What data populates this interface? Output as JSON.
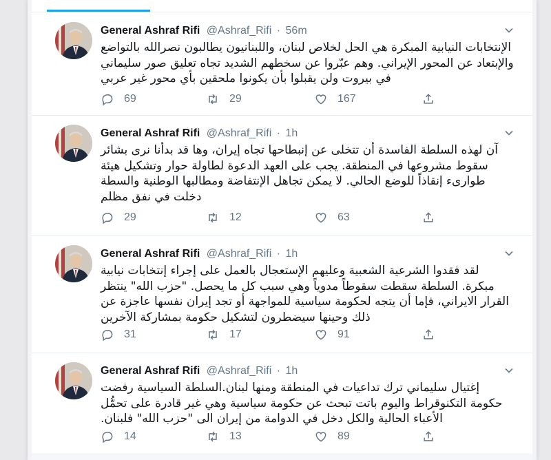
{
  "colors": {
    "accent": "#1da1f2",
    "text": "#14171a",
    "muted": "#657786",
    "divider": "#e6ecf0"
  },
  "icons": {
    "reply": "reply-icon",
    "retweet": "retweet-icon",
    "like": "heart-icon",
    "share": "share-icon",
    "menu": "chevron-down-icon"
  },
  "tweets": [
    {
      "name": "General Ashraf Rifi",
      "handle": "@Ashraf_Rifi",
      "separator": "·",
      "time": "56m",
      "text": "الإنتخابات النيابية المبكرة هي الحل لخلاص لبنان، واللبنانيون يطالبون نصرالله بالتواضع والإبتعاد عن المحور الإيراني. وهم عبّروا عن سخطهم الشديد تجاه تعليق صور سليماني في بيروت ولن يقبلوا بأن يكونوا ملحقين بأي محور غير عربي",
      "replies": "69",
      "retweets": "29",
      "likes": "167"
    },
    {
      "name": "General Ashraf Rifi",
      "handle": "@Ashraf_Rifi",
      "separator": "·",
      "time": "1h",
      "text": "آن لهذه السلطة الفاسدة أن تتخلى عن إنبطاحها تجاه إيران، وها قد بدأنا نرى بشائر سقوط مشروعها في المنطقة. يجب على العهد الدعوة لطاولة حوار وتشكيل هيئة طوارىء إنقاذاً للوضع الحالي. لا يمكن تجاهل الإنتفاضة ومطالبها الوطنية والسطة دخلت في نفق مظلم",
      "replies": "29",
      "retweets": "12",
      "likes": "63"
    },
    {
      "name": "General Ashraf Rifi",
      "handle": "@Ashraf_Rifi",
      "separator": "·",
      "time": "1h",
      "text": "لقد فقدوا الشرعية الشعبية وعليهم الإستعجال بالعمل على إجراء إنتخابات نيابية مبكرة. السلطة سقطت سقوطاً مدوياً وهي سبب كل ما يحصل. \"حزب الله\" ينتظر القرار الايراني، فإما أن يتجه لحكومة سياسية للمواجهة أو تجد إيران نفسها عاجزة عن ذلك وحينها سيضطرون لتشكيل حكومة بمشاركة الآخرين",
      "replies": "31",
      "retweets": "17",
      "likes": "91"
    },
    {
      "name": "General Ashraf Rifi",
      "handle": "@Ashraf_Rifi",
      "separator": "·",
      "time": "1h",
      "text": "إغتيال سليماني ترك تداعيات في المنطقة ومنها لبنان.السلطة السياسية رفضت حكومة التكنوقراط واليوم باتت تبحث عن حكومة سياسية وهي غير قادرة على تحمُّل الأعباء الحالية والكل دخل في الدوامة من إيران الى \"حزب الله\" فلبنان.",
      "replies": "14",
      "retweets": "13",
      "likes": "89"
    }
  ]
}
